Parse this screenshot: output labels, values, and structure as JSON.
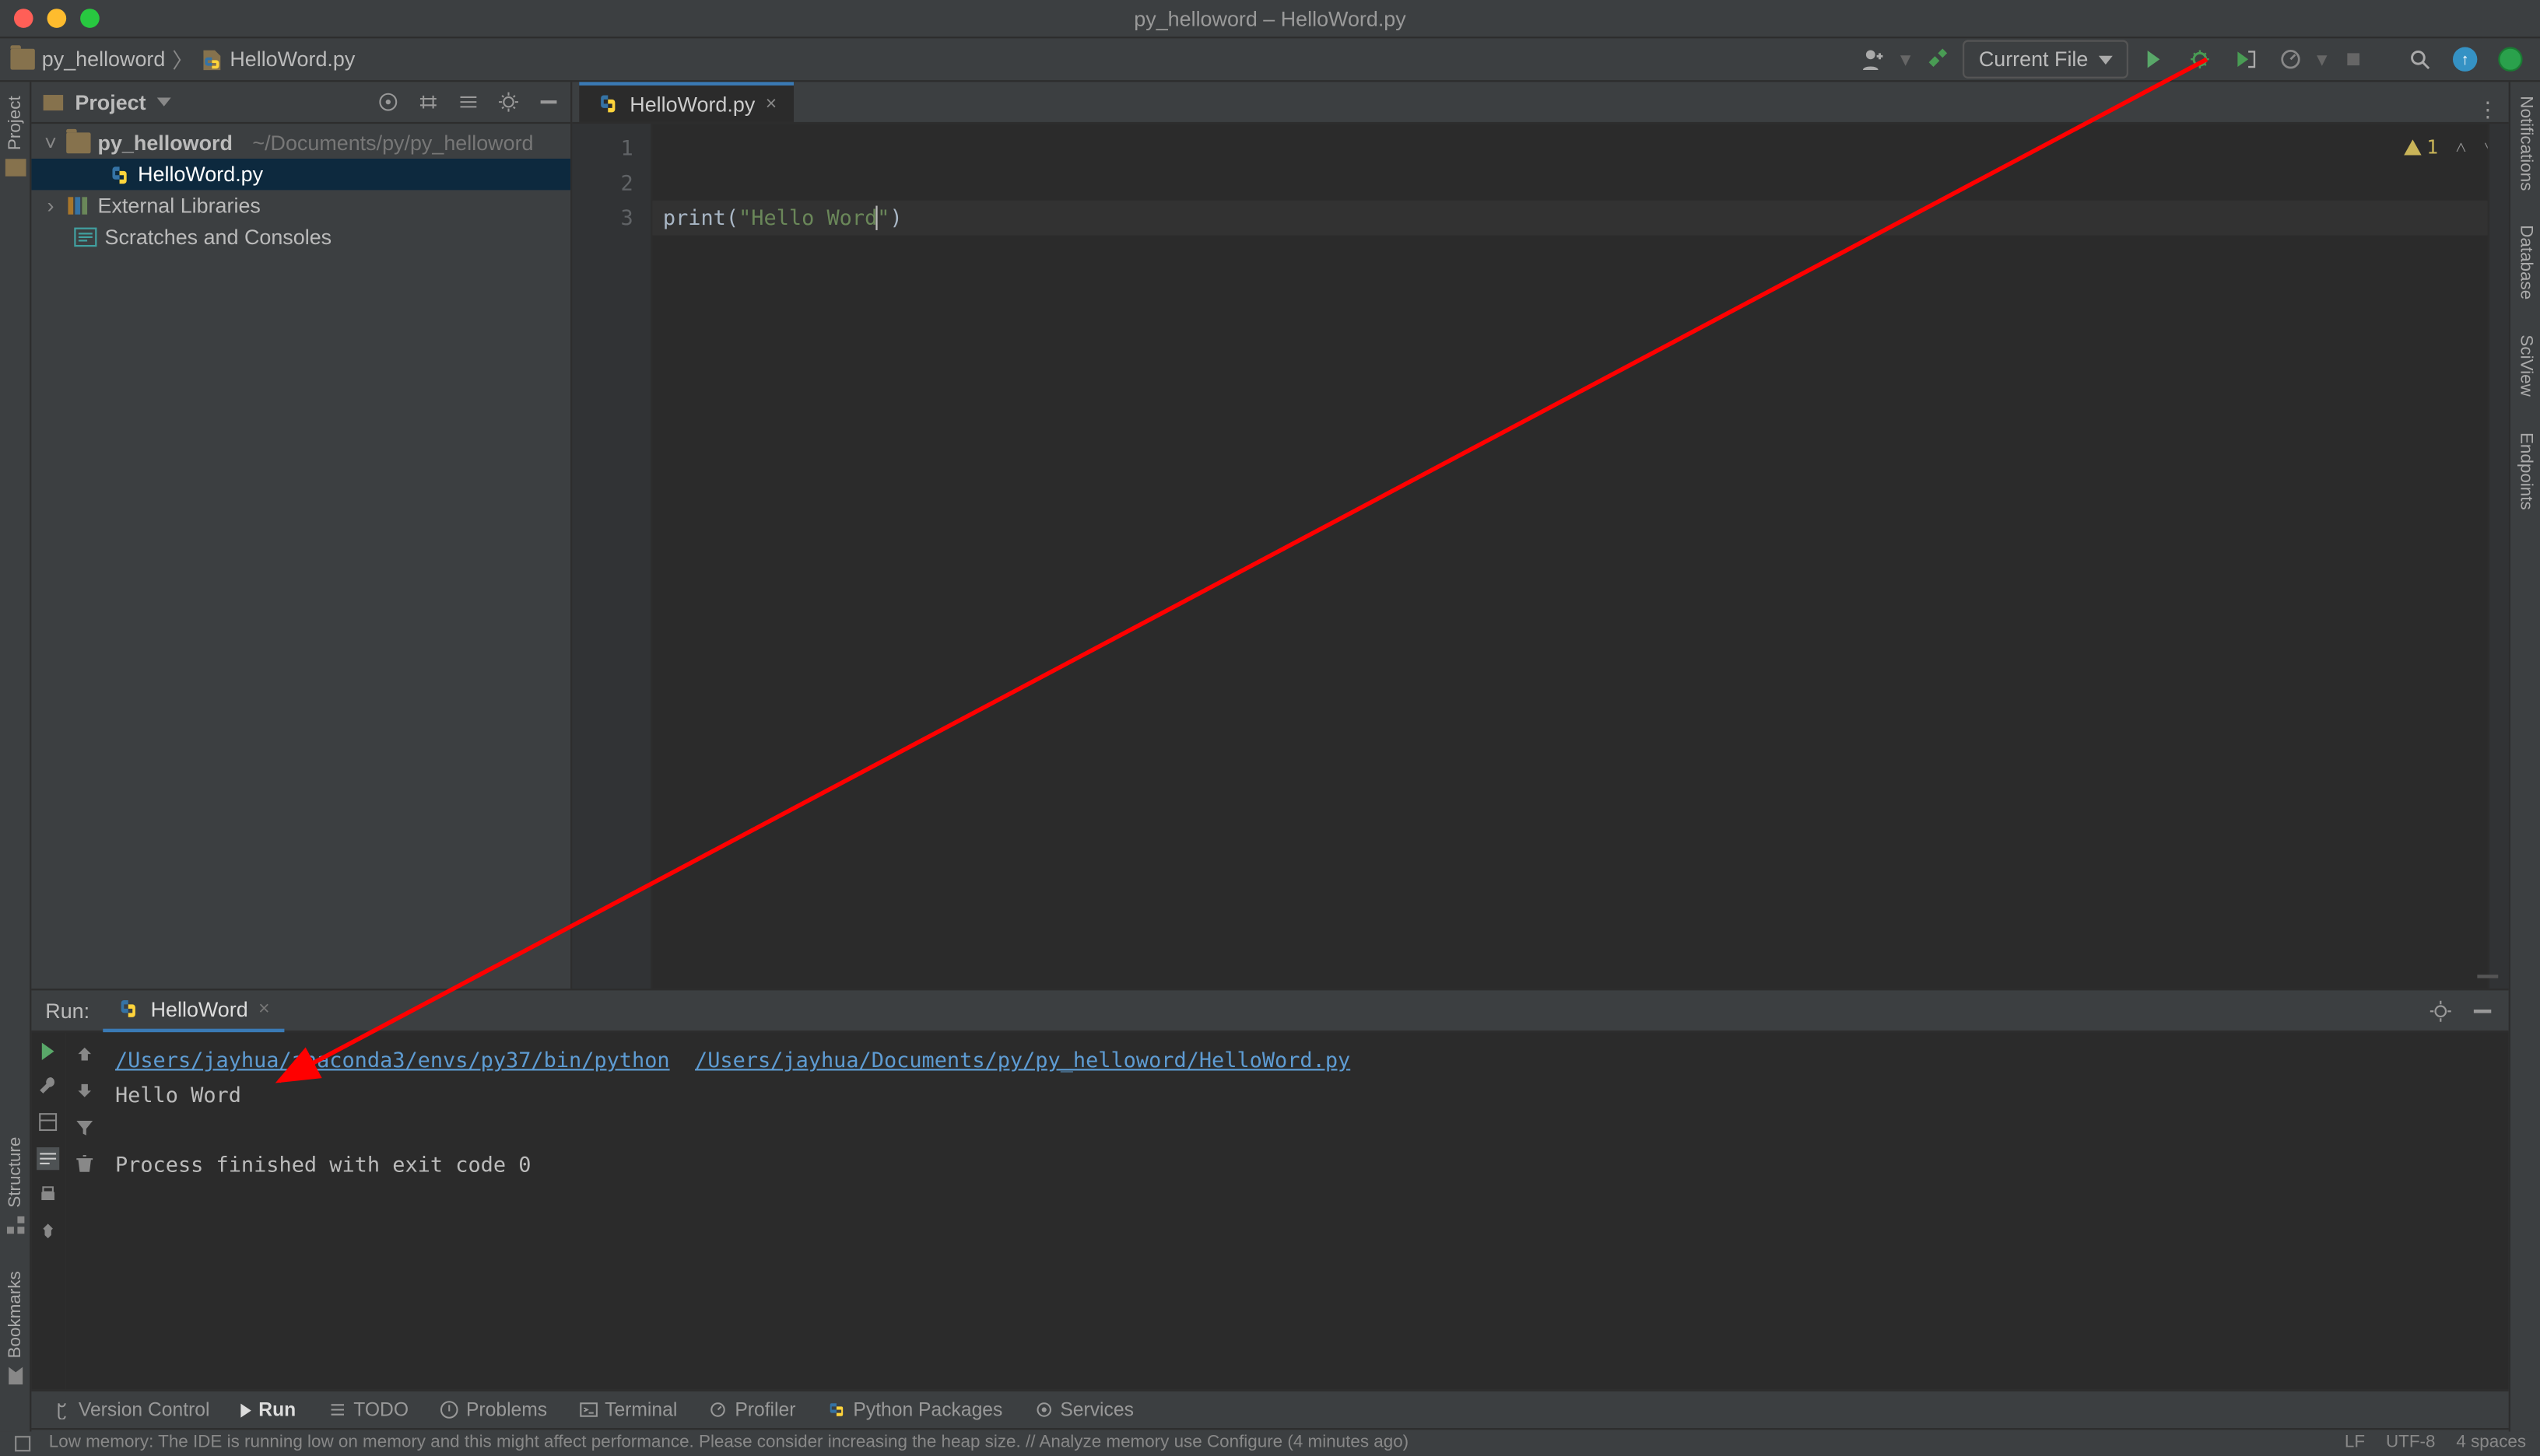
{
  "window": {
    "title": "py_helloword – HelloWord.py"
  },
  "breadcrumb": {
    "root": "py_helloword",
    "file": "HelloWord.py"
  },
  "runConfig": {
    "label": "Current File"
  },
  "sidebars": {
    "left": [
      "Project",
      "Bookmarks",
      "Structure"
    ],
    "right": [
      "Notifications",
      "Database",
      "SciView",
      "Endpoints"
    ]
  },
  "projectTW": {
    "title": "Project",
    "tree": {
      "root": {
        "name": "py_helloword",
        "path": "~/Documents/py/py_helloword"
      },
      "file": "HelloWord.py",
      "external": "External Libraries",
      "scratches": "Scratches and Consoles"
    }
  },
  "editor": {
    "tab": "HelloWord.py",
    "gutter": [
      "1",
      "2",
      "3"
    ],
    "code": {
      "kw": "print",
      "open": "(",
      "strOpen": "\"",
      "strBody": "Hello Word",
      "strClose": "\"",
      "close": ")"
    },
    "problems": {
      "count": "1"
    }
  },
  "runTW": {
    "title": "Run:",
    "tab": "HelloWord",
    "pythonPath": "/Users/jayhua/anaconda3/envs/py37/bin/python",
    "scriptPath": "/Users/jayhua/Documents/py/py_helloword/HelloWord.py",
    "stdout": "Hello Word",
    "exit": "Process finished with exit code 0"
  },
  "bottomBar": {
    "items": [
      "Version Control",
      "Run",
      "TODO",
      "Problems",
      "Terminal",
      "Profiler",
      "Python Packages",
      "Services"
    ]
  },
  "statusBar": {
    "msg": "Low memory: The IDE is running low on memory and this might affect performance. Please consider increasing the heap size. // Analyze memory use   Configure (4 minutes ago)",
    "right": [
      "LF",
      "UTF-8",
      "4 spaces"
    ]
  }
}
